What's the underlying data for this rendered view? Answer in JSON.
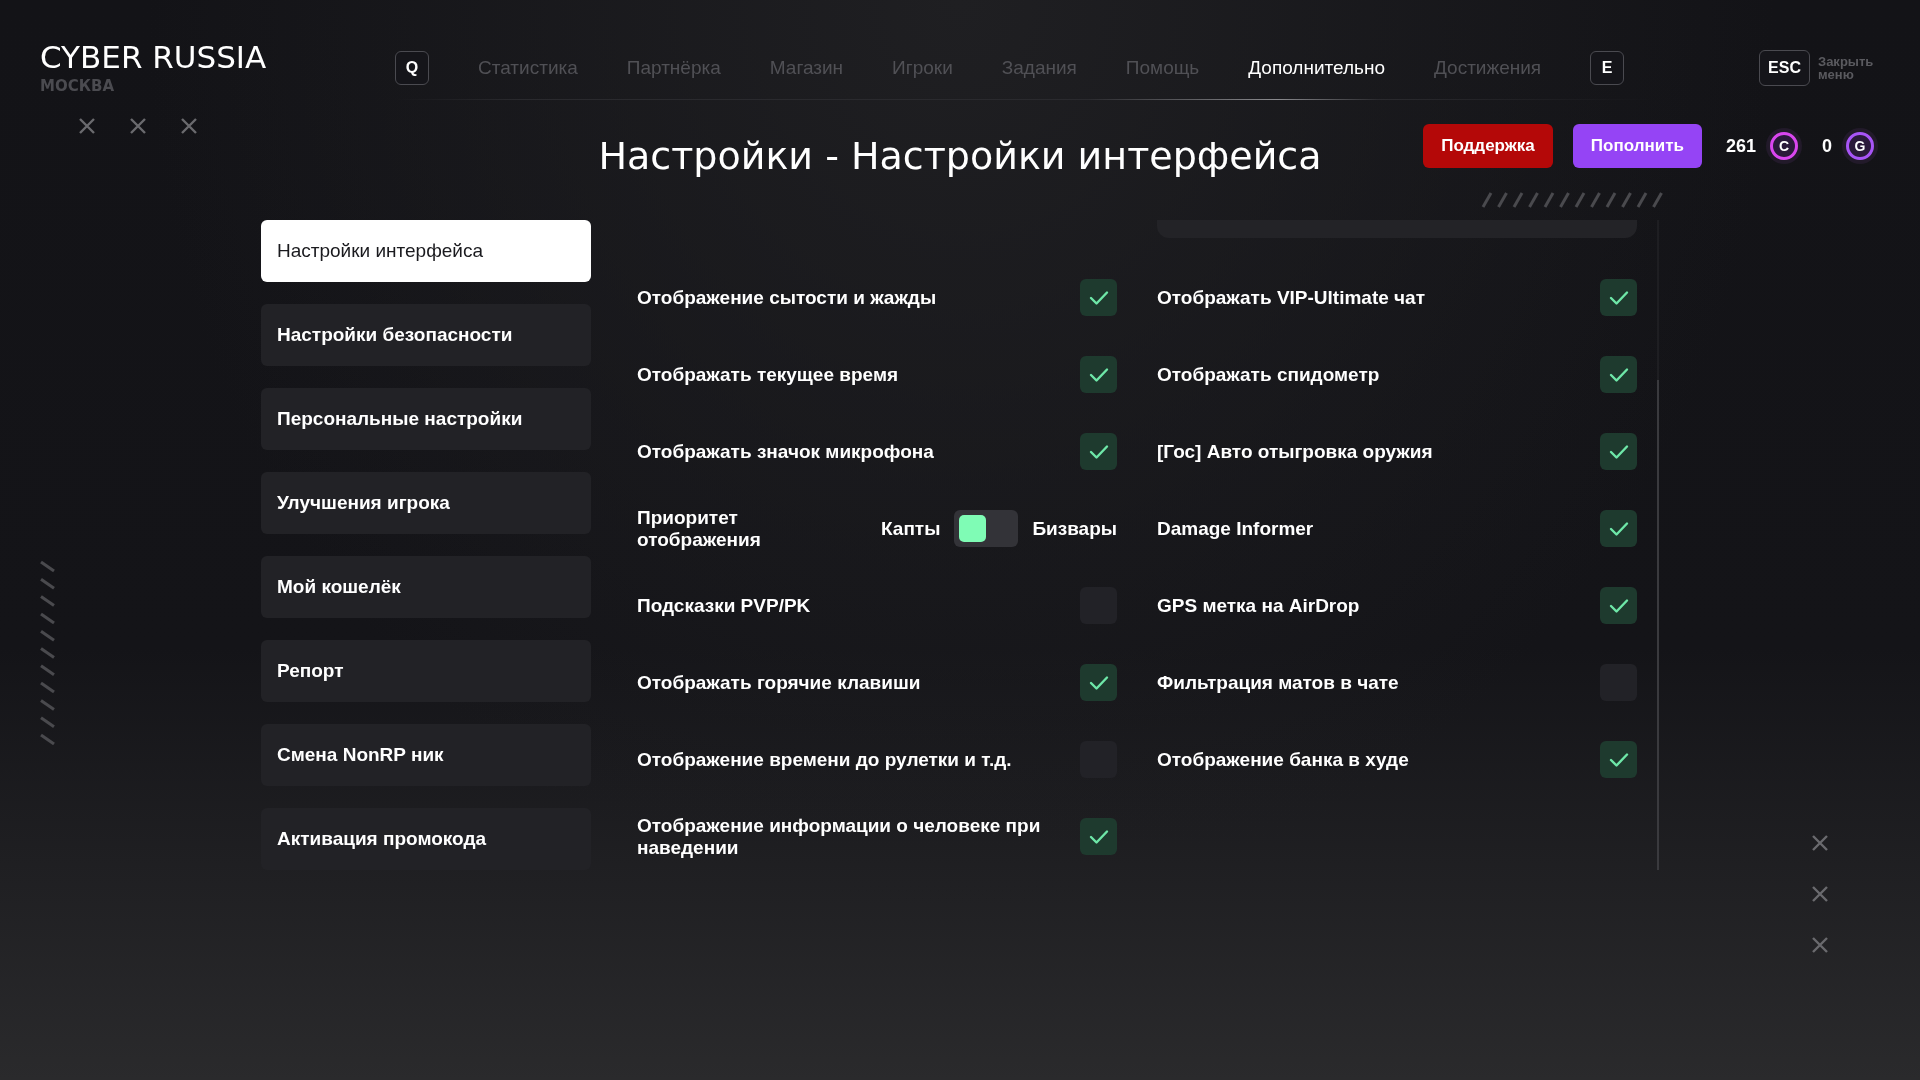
{
  "header": {
    "logo": "CYBER RUSSIA",
    "city": "МОСКВА"
  },
  "nav": {
    "left_key": "Q",
    "right_key": "E",
    "tabs": [
      {
        "label": "Статистика",
        "selected": false
      },
      {
        "label": "Партнёрка",
        "selected": false
      },
      {
        "label": "Магазин",
        "selected": false
      },
      {
        "label": "Игроки",
        "selected": false
      },
      {
        "label": "Задания",
        "selected": false
      },
      {
        "label": "Помощь",
        "selected": false
      },
      {
        "label": "Дополнительно",
        "selected": true
      },
      {
        "label": "Достижения",
        "selected": false
      }
    ]
  },
  "close_menu": {
    "key": "ESC",
    "label": "Закрыть меню"
  },
  "title": "Настройки - Настройки интерфейса",
  "actions": {
    "support": "Поддержка",
    "top_up": "Пополнить"
  },
  "currencies": [
    {
      "amount": "261",
      "symbol": "C",
      "color": "#d946ef"
    },
    {
      "amount": "0",
      "symbol": "G",
      "color": "#a855f7"
    }
  ],
  "sidebar": {
    "items": [
      {
        "label": "Настройки интерфейса",
        "selected": true
      },
      {
        "label": "Настройки безопасности",
        "selected": false
      },
      {
        "label": "Персональные настройки",
        "selected": false
      },
      {
        "label": "Улучшения игрока",
        "selected": false
      },
      {
        "label": "Мой кошелёк",
        "selected": false
      },
      {
        "label": "Репорт",
        "selected": false
      },
      {
        "label": "Смена NonRP ник",
        "selected": false
      },
      {
        "label": "Активация промокода",
        "selected": false
      }
    ]
  },
  "settings": {
    "left": [
      {
        "kind": "checkbox",
        "label": "Отображение сытости и жажды",
        "checked": true
      },
      {
        "kind": "checkbox",
        "label": "Отображать текущее время",
        "checked": true
      },
      {
        "kind": "checkbox",
        "label": "Отображать значок микрофона",
        "checked": true
      },
      {
        "kind": "choice",
        "label": "Приоритет отображения",
        "left_option": "Капты",
        "right_option": "Бизвары",
        "on": false
      },
      {
        "kind": "checkbox",
        "label": "Подсказки PVP/PK",
        "checked": false
      },
      {
        "kind": "checkbox",
        "label": "Отображать горячие клавиши",
        "checked": true
      },
      {
        "kind": "checkbox",
        "label": "Отображение времени до рулетки и т.д.",
        "checked": false
      },
      {
        "kind": "checkbox",
        "label": "Отображение информации о человеке при наведении",
        "checked": true
      }
    ],
    "right": [
      {
        "kind": "checkbox",
        "label": "Отображать VIP-Ultimate чат",
        "checked": true
      },
      {
        "kind": "checkbox",
        "label": "Отображать спидометр",
        "checked": true
      },
      {
        "kind": "checkbox",
        "label": "[Гос] Авто отыгровка оружия",
        "checked": true
      },
      {
        "kind": "checkbox",
        "label": "Damage Informer",
        "checked": true
      },
      {
        "kind": "checkbox",
        "label": "GPS метка на AirDrop",
        "checked": true
      },
      {
        "kind": "checkbox",
        "label": "Фильтрация матов в чате",
        "checked": false
      },
      {
        "kind": "checkbox",
        "label": "Отображение банка в худе",
        "checked": true
      }
    ]
  }
}
